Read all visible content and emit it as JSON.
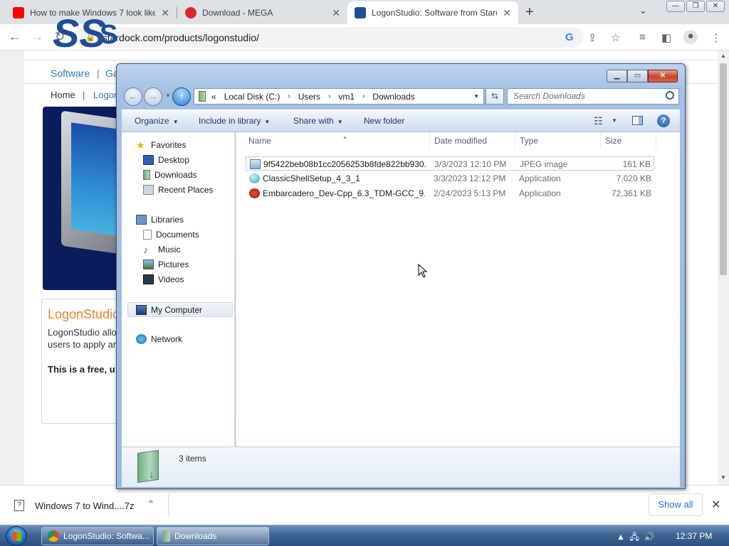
{
  "browser": {
    "tabs": [
      {
        "title": "How to make Windows 7 look like",
        "favicon_color": "#ff0000"
      },
      {
        "title": "Download - MEGA",
        "favicon_color": "#d9272e"
      },
      {
        "title": "LogonStudio: Software from Stardock",
        "favicon_color": "#1f4e96"
      }
    ],
    "url": "stardock.com/products/logonstudio/"
  },
  "webpage": {
    "logo_letters": "SS",
    "logo_text": "S",
    "nav": {
      "software": "Software",
      "games_partial": "Ga"
    },
    "crumbs": {
      "home": "Home",
      "separator": "|",
      "current_partial": "Logon"
    },
    "product": {
      "title_partial": "LogonStudio",
      "desc_line1": "LogonStudio allo",
      "desc_line2": "users to apply an",
      "free_line": "This is a free, u"
    }
  },
  "downloads_bar": {
    "item": "Windows 7 to Wind....7z",
    "show_all": "Show all"
  },
  "taskbar": {
    "items": [
      {
        "label": "LogonStudio: Softwa..."
      },
      {
        "label": "Downloads"
      }
    ],
    "clock": "12:37 PM"
  },
  "explorer": {
    "address": {
      "overflow": "«",
      "segments": [
        "Local Disk (C:)",
        "Users",
        "vm1",
        "Downloads"
      ]
    },
    "search_placeholder": "Search Downloads",
    "commands": {
      "organize": "Organize",
      "include_in_library": "Include in library",
      "share_with": "Share with",
      "new_folder": "New folder"
    },
    "nav": {
      "favorites": "Favorites",
      "desktop": "Desktop",
      "downloads": "Downloads",
      "recent_places": "Recent Places",
      "libraries": "Libraries",
      "documents": "Documents",
      "music": "Music",
      "pictures": "Pictures",
      "videos": "Videos",
      "my_computer": "My Computer",
      "network": "Network"
    },
    "columns": {
      "name": "Name",
      "date": "Date modified",
      "type": "Type",
      "size": "Size"
    },
    "files": [
      {
        "name": "9f5422beb08b1cc2056253b8fde822bb930...",
        "date": "3/3/2023 12:10 PM",
        "type": "JPEG image",
        "size": "161 KB"
      },
      {
        "name": "ClassicShellSetup_4_3_1",
        "date": "3/3/2023 12:12 PM",
        "type": "Application",
        "size": "7,020 KB"
      },
      {
        "name": "Embarcadero_Dev-Cpp_6.3_TDM-GCC_9....",
        "date": "2/24/2023 5:13 PM",
        "type": "Application",
        "size": "72,361 KB"
      }
    ],
    "item_count": "3 items"
  }
}
